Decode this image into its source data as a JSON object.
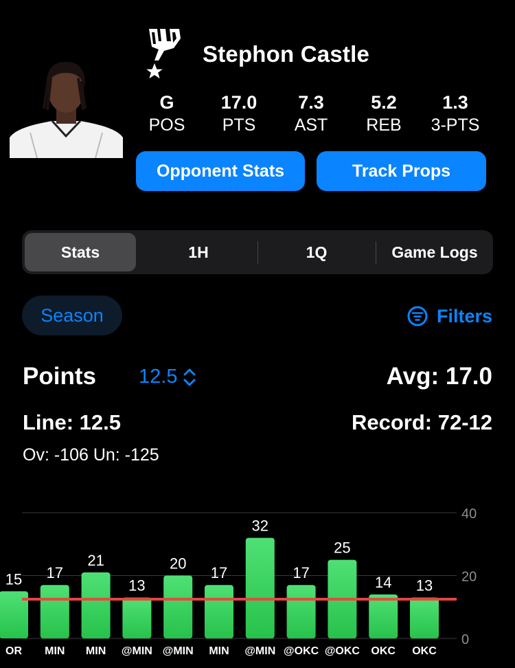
{
  "player": {
    "name": "Stephon Castle",
    "team_logo_icon": "spurs-logo-icon",
    "stats": [
      {
        "value": "G",
        "label": "POS"
      },
      {
        "value": "17.0",
        "label": "PTS"
      },
      {
        "value": "7.3",
        "label": "AST"
      },
      {
        "value": "5.2",
        "label": "REB"
      },
      {
        "value": "1.3",
        "label": "3-PTS"
      }
    ]
  },
  "actions": {
    "opponent_stats": "Opponent Stats",
    "track_props": "Track Props"
  },
  "tabs": [
    {
      "label": "Stats",
      "active": true
    },
    {
      "label": "1H",
      "active": false
    },
    {
      "label": "1Q",
      "active": false
    },
    {
      "label": "Game Logs",
      "active": false
    }
  ],
  "filters": {
    "season": "Season",
    "filters_label": "Filters"
  },
  "prop": {
    "metric": "Points",
    "line_value": "12.5",
    "avg": "Avg: 17.0",
    "line": "Line: 12.5",
    "record": "Record: 72-12",
    "odds": "Ov: -106  Un: -125"
  },
  "colors": {
    "accent": "#0a84ff",
    "bar_green": "#30d158",
    "line_red": "#e5483f",
    "background": "#000000"
  },
  "chart_data": {
    "type": "bar",
    "categories": [
      "OR",
      "MIN",
      "MIN",
      "@MIN",
      "@MIN",
      "MIN",
      "@MIN",
      "@OKC",
      "@OKC",
      "OKC",
      "OKC"
    ],
    "values": [
      15,
      17,
      21,
      13,
      20,
      17,
      32,
      17,
      25,
      14,
      13
    ],
    "value_labels": [
      "15",
      "17",
      "21",
      "13",
      "20",
      "17",
      "32",
      "17",
      "25",
      "14",
      "13"
    ],
    "line": 12.5,
    "y_ticks": [
      "40",
      "20",
      "0"
    ],
    "ylim": [
      0,
      40
    ],
    "grid": true
  }
}
